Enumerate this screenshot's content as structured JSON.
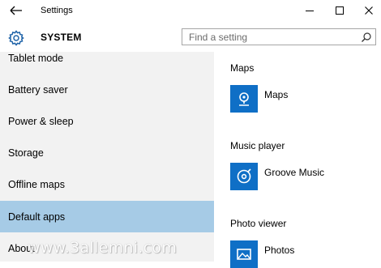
{
  "window": {
    "title": "Settings",
    "controls": {
      "back": "back-arrow-icon",
      "minimize": "minimize-icon",
      "maximize": "maximize-icon",
      "close": "close-icon"
    }
  },
  "header": {
    "icon": "gear-icon",
    "title": "SYSTEM",
    "search": {
      "placeholder": "Find a setting",
      "value": "",
      "icon": "search-icon"
    }
  },
  "sidebar": {
    "items": [
      {
        "label": "Tablet mode"
      },
      {
        "label": "Battery saver"
      },
      {
        "label": "Power & sleep"
      },
      {
        "label": "Storage"
      },
      {
        "label": "Offline maps"
      },
      {
        "label": "Default apps",
        "selected": true
      },
      {
        "label": "About"
      }
    ],
    "selected_color": "#a6cbe6",
    "background": "#f2f2f2"
  },
  "main": {
    "sections": [
      {
        "title": "Maps",
        "app": {
          "name": "Maps",
          "icon": "maps-icon"
        }
      },
      {
        "title": "Music player",
        "app": {
          "name": "Groove Music",
          "icon": "groove-music-icon"
        }
      },
      {
        "title": "Photo viewer",
        "app": {
          "name": "Photos",
          "icon": "photos-icon"
        }
      }
    ],
    "tile_color": "#0f6fc6"
  },
  "watermark": "www.3allemni.com"
}
